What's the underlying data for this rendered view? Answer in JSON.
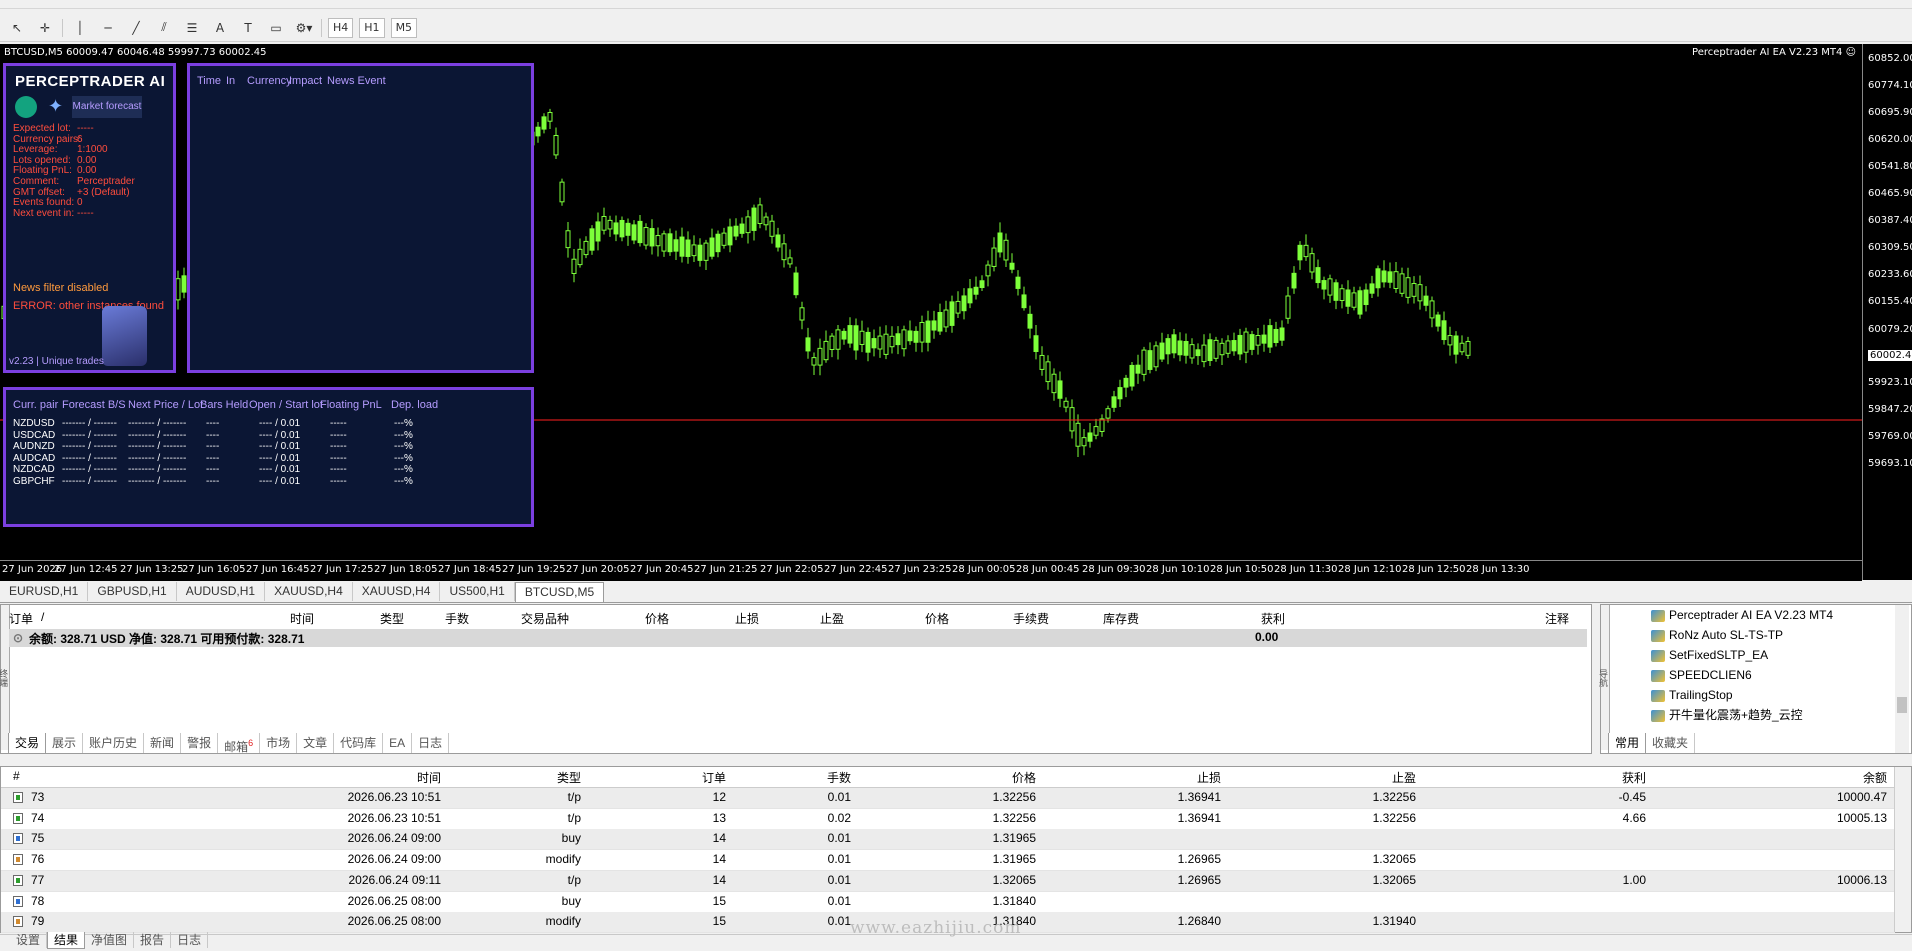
{
  "toolbar": {
    "timeframes": [
      "H4",
      "H1",
      "M5"
    ],
    "draw_tools": [
      "cursor",
      "crosshair",
      "vertical-line",
      "horizontal-line",
      "trendline",
      "channel",
      "fibo",
      "text",
      "label",
      "rectangle",
      "shapes"
    ]
  },
  "chart": {
    "symbol_header": "BTCUSD,M5  60009.47 60046.48 59997.73 60002.45",
    "ea_header": "Perceptrader AI EA V2.23 MT4 ☺",
    "price_labels": [
      "60852.00",
      "60774.10",
      "60695.90",
      "60620.00",
      "60541.80",
      "60465.90",
      "60387.40",
      "60309.50",
      "60233.60",
      "60155.40",
      "60079.20",
      "60002.45",
      "59923.10",
      "59847.20",
      "59769.00",
      "59693.10"
    ],
    "current_price": "60002.45",
    "time_labels": [
      "27 Jun 2026",
      "27 Jun 12:45",
      "27 Jun 13:25",
      "27 Jun 16:05",
      "27 Jun 16:45",
      "27 Jun 17:25",
      "27 Jun 18:05",
      "27 Jun 18:45",
      "27 Jun 19:25",
      "27 Jun 20:05",
      "27 Jun 20:45",
      "27 Jun 21:25",
      "27 Jun 22:05",
      "27 Jun 22:45",
      "27 Jun 23:25",
      "28 Jun 00:05",
      "28 Jun 00:45",
      "28 Jun 09:30",
      "28 Jun 10:10",
      "28 Jun 10:50",
      "28 Jun 11:30",
      "28 Jun 12:10",
      "28 Jun 12:50",
      "28 Jun 13:30"
    ],
    "colors": {
      "candle": "#7dff3a",
      "bg": "#000000",
      "bid_line": "#ff2020",
      "panel_border": "#7b3fe0",
      "panel_bg": "#0b1634"
    }
  },
  "ea_panel": {
    "brand": "PERCEPTRADER AI",
    "market_forecast": "Market forecast",
    "stats": [
      {
        "label": "Expected lot:",
        "value": "-----"
      },
      {
        "label": "Currency pairs:",
        "value": "6"
      },
      {
        "label": "Leverage:",
        "value": "1:1000"
      },
      {
        "label": "Lots opened:",
        "value": "0.00"
      },
      {
        "label": "Floating PnL:",
        "value": "0.00"
      },
      {
        "label": "Comment:",
        "value": "Perceptrader"
      },
      {
        "label": "GMT offset:",
        "value": "+3 (Default)"
      },
      {
        "label": "Events found:",
        "value": "0"
      },
      {
        "label": "Next event in:",
        "value": "-----"
      }
    ],
    "news_filter": "News filter disabled",
    "error": "ERROR: other instances found",
    "version": "v2.23 | Unique trades"
  },
  "news_panel": {
    "headers": [
      "Time",
      "In",
      "Currency",
      "Impact",
      "News Event"
    ]
  },
  "pairs_panel": {
    "headers": [
      "Curr. pair",
      "Forecast B/S",
      "Next Price / Lot",
      "Bars Held",
      "Open / Start lot",
      "Floating PnL",
      "Dep. load"
    ],
    "rows": [
      {
        "pair": "NZDUSD",
        "forecast": "------- / -------",
        "next": "-------- / -------",
        "bars": "----",
        "open": "---- / 0.01",
        "pnl": "-----",
        "load": "---%"
      },
      {
        "pair": "USDCAD",
        "forecast": "------- / -------",
        "next": "-------- / -------",
        "bars": "----",
        "open": "---- / 0.01",
        "pnl": "-----",
        "load": "---%"
      },
      {
        "pair": "AUDNZD",
        "forecast": "------- / -------",
        "next": "-------- / -------",
        "bars": "----",
        "open": "---- / 0.01",
        "pnl": "-----",
        "load": "---%"
      },
      {
        "pair": "AUDCAD",
        "forecast": "------- / -------",
        "next": "-------- / -------",
        "bars": "----",
        "open": "---- / 0.01",
        "pnl": "-----",
        "load": "---%"
      },
      {
        "pair": "NZDCAD",
        "forecast": "------- / -------",
        "next": "-------- / -------",
        "bars": "----",
        "open": "---- / 0.01",
        "pnl": "-----",
        "load": "---%"
      },
      {
        "pair": "GBPCHF",
        "forecast": "------- / -------",
        "next": "-------- / -------",
        "bars": "----",
        "open": "---- / 0.01",
        "pnl": "-----",
        "load": "---%"
      }
    ]
  },
  "symbol_tabs": [
    "EURUSD,H1",
    "GBPUSD,H1",
    "AUDUSD,H1",
    "XAUUSD,H4",
    "XAUUSD,H4",
    "US500,H1",
    "BTCUSD,M5"
  ],
  "active_symbol_tab": "BTCUSD,M5",
  "terminal": {
    "headers": [
      "订单",
      "/",
      "时间",
      "类型",
      "手数",
      "交易品种",
      "价格",
      "止损",
      "止盈",
      "价格",
      "手续费",
      "库存费",
      "获利",
      "注释"
    ],
    "balance_line": "余额: 328.71 USD  净值: 328.71  可用预付款: 328.71",
    "balance_profit": "0.00",
    "tabs": [
      "交易",
      "展示",
      "账户历史",
      "新闻",
      "警报",
      "邮箱",
      "市场",
      "文章",
      "代码库",
      "EA",
      "日志"
    ],
    "mail_badge": "6",
    "side_label": "终端"
  },
  "navigator": {
    "items": [
      "Perceptrader AI EA V2.23 MT4",
      "RoNz Auto SL-TS-TP",
      "SetFixedSLTP_EA",
      "SPEEDCLIEN6",
      "TrailingStop",
      "开牛量化震荡+趋势_云控"
    ],
    "tabs": [
      "常用",
      "收藏夹"
    ],
    "side_label": "导航"
  },
  "tester": {
    "headers": [
      "#",
      "时间",
      "类型",
      "订单",
      "手数",
      "价格",
      "止损",
      "止盈",
      "获利",
      "余额"
    ],
    "rows": [
      {
        "n": "73",
        "time": "2026.06.23 10:51",
        "type": "t/p",
        "order": "12",
        "lots": "0.01",
        "price": "1.32256",
        "sl": "1.36941",
        "tp": "1.32256",
        "profit": "-0.45",
        "balance": "10000.47",
        "icon": "tp"
      },
      {
        "n": "74",
        "time": "2026.06.23 10:51",
        "type": "t/p",
        "order": "13",
        "lots": "0.02",
        "price": "1.32256",
        "sl": "1.36941",
        "tp": "1.32256",
        "profit": "4.66",
        "balance": "10005.13",
        "icon": "tp"
      },
      {
        "n": "75",
        "time": "2026.06.24 09:00",
        "type": "buy",
        "order": "14",
        "lots": "0.01",
        "price": "1.31965",
        "sl": "",
        "tp": "",
        "profit": "",
        "balance": "",
        "icon": "buy"
      },
      {
        "n": "76",
        "time": "2026.06.24 09:00",
        "type": "modify",
        "order": "14",
        "lots": "0.01",
        "price": "1.31965",
        "sl": "1.26965",
        "tp": "1.32065",
        "profit": "",
        "balance": "",
        "icon": "mod"
      },
      {
        "n": "77",
        "time": "2026.06.24 09:11",
        "type": "t/p",
        "order": "14",
        "lots": "0.01",
        "price": "1.32065",
        "sl": "1.26965",
        "tp": "1.32065",
        "profit": "1.00",
        "balance": "10006.13",
        "icon": "tp"
      },
      {
        "n": "78",
        "time": "2026.06.25 08:00",
        "type": "buy",
        "order": "15",
        "lots": "0.01",
        "price": "1.31840",
        "sl": "",
        "tp": "",
        "profit": "",
        "balance": "",
        "icon": "buy"
      },
      {
        "n": "79",
        "time": "2026.06.25 08:00",
        "type": "modify",
        "order": "15",
        "lots": "0.01",
        "price": "1.31840",
        "sl": "1.26840",
        "tp": "1.31940",
        "profit": "",
        "balance": "",
        "icon": "mod"
      }
    ],
    "tabs": [
      "设置",
      "结果",
      "净值图",
      "报告",
      "日志"
    ],
    "active_tab": "结果"
  },
  "watermark": "www.eazhijiu.com"
}
